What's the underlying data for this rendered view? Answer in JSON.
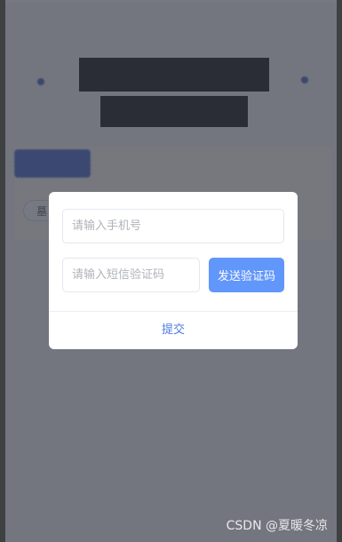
{
  "page": {
    "title": "",
    "panel_button": "",
    "chip": "墓"
  },
  "dialog": {
    "phone_placeholder": "请输入手机号",
    "code_placeholder": "请输入短信验证码",
    "send_code_label": "发送验证码",
    "submit_label": "提交"
  },
  "watermark": "CSDN @夏暖冬凉",
  "colors": {
    "accent": "#6196fb",
    "link": "#4f7be0",
    "overlay": "#3c404c",
    "brand_blue": "#3b5bb5"
  },
  "icons": [
    "left-dot-icon",
    "right-dot-icon"
  ]
}
